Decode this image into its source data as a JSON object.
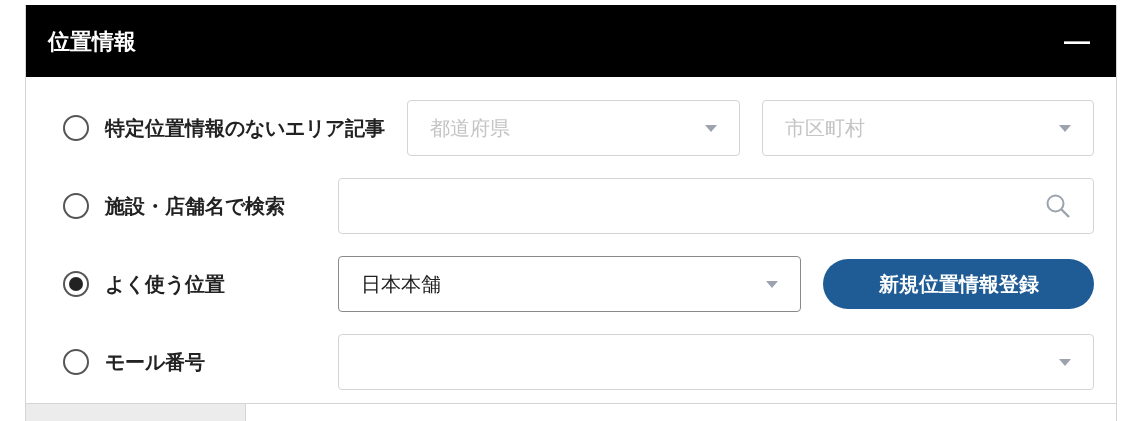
{
  "panel": {
    "title": "位置情報",
    "collapse_symbol": "—"
  },
  "options": [
    {
      "kind": "two-selects",
      "label": "特定位置情報のないエリア記事",
      "selected": false,
      "fields": [
        {
          "placeholder": "都道府県"
        },
        {
          "placeholder": "市区町村"
        }
      ]
    },
    {
      "kind": "search",
      "label": "施設・店舗名で検索",
      "selected": false
    },
    {
      "kind": "select-button",
      "label": "よく使う位置",
      "selected": true,
      "value": "日本本舗",
      "button": "新規位置情報登録"
    },
    {
      "kind": "select",
      "label": "モール番号",
      "selected": false
    }
  ]
}
